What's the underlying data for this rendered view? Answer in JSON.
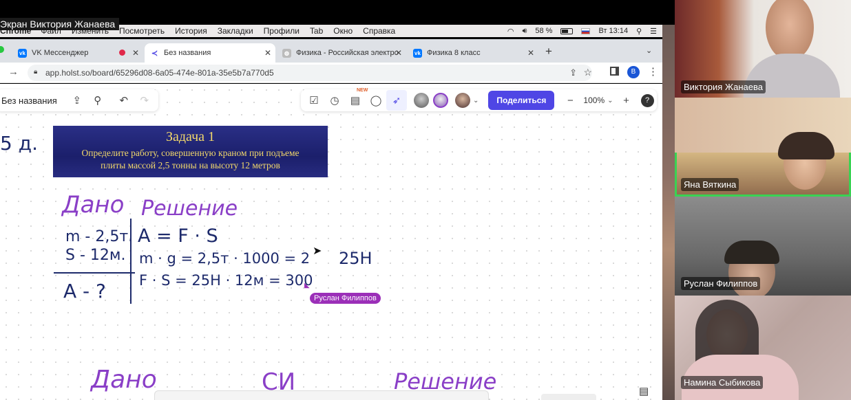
{
  "share": {
    "label": "Экран Виктория Жанаева",
    "menubar": {
      "app": "Chrome",
      "items": [
        "Файл",
        "Изменить",
        "Посмотреть",
        "История",
        "Закладки",
        "Профили",
        "Tab",
        "Окно",
        "Справка"
      ],
      "battery": "58 %",
      "clock": "Вт 13:14"
    },
    "tabs": [
      {
        "label": "VK Мессенджер"
      },
      {
        "label": "Без названия"
      },
      {
        "label": "Физика - Российская электро"
      },
      {
        "label": "Физика 8 класс"
      }
    ],
    "url": "app.holst.so/board/65296d08-6a05-474e-801a-35e5b7a770d5",
    "profile_initial": "B",
    "board": {
      "title": "Без названия",
      "new_badge": "NEW",
      "share_button": "Поделиться",
      "zoom": "100%",
      "help": "?"
    },
    "task": {
      "title": "Задача 1",
      "line1": "Определите работу, совершенную краном при подъеме",
      "line2": "плиты массой 2,5 тонны на высоту 12 метров"
    },
    "handwriting": {
      "left_edge": "5 д.",
      "dano": "Дано",
      "reshenie": "Решение",
      "m": "m - 2,5т.",
      "s": "S - 12м.",
      "a_q": "A - ?",
      "f1": "A = F · S",
      "f2": "m · g = 2,5т · 1000 = 2",
      "f2b": "25H",
      "f3": "F · S = 25H · 12м = 300",
      "bottom_dano": "Дано",
      "bottom_si": "СИ",
      "bottom_reshenie": "Решение"
    },
    "cursor_user": "Руслан Филиппов"
  },
  "participants": [
    {
      "name": "Виктория Жанаева"
    },
    {
      "name": "Яна Вяткина"
    },
    {
      "name": "Руслан Филиппов"
    },
    {
      "name": "Намина Сыбикова"
    }
  ],
  "colors": {
    "accent": "#4f46e5",
    "speaking": "#39d353",
    "ink_purple": "#8a3fc7",
    "ink_blue": "#1d2a6b"
  }
}
